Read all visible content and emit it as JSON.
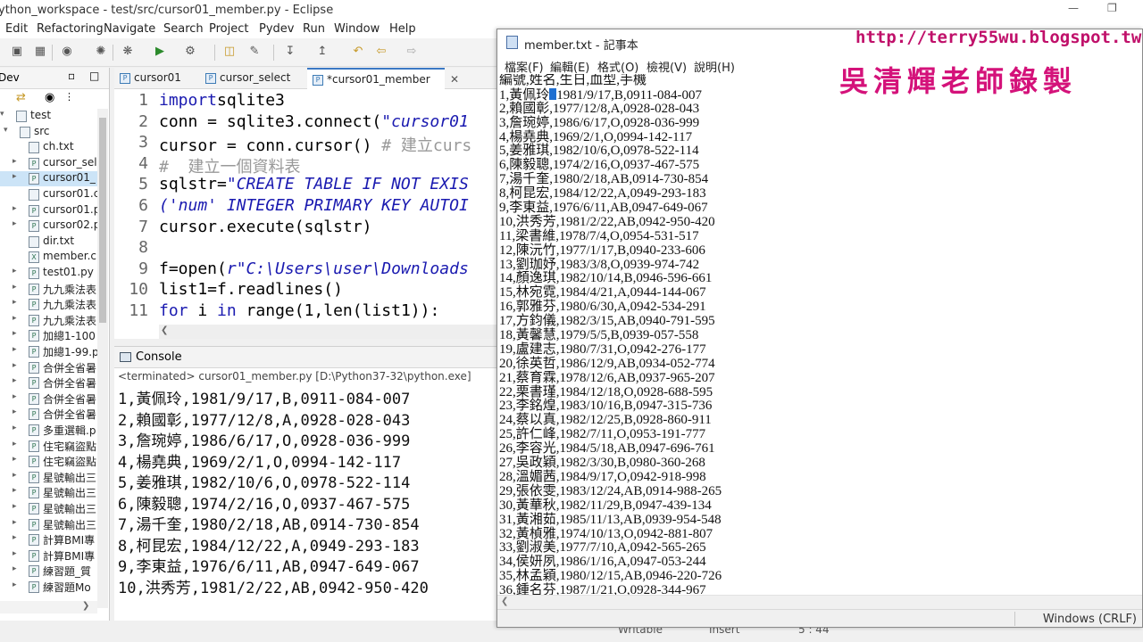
{
  "eclipse": {
    "title": "ython_workspace - test/src/cursor01_member.py - Eclipse",
    "menu": [
      "Edit",
      "Refactoring",
      "Navigate",
      "Search",
      "Project",
      "Pydev",
      "Run",
      "Window",
      "Help"
    ],
    "pkg_tab": "Dev",
    "tree": [
      {
        "label": "test",
        "kind": "project",
        "level": 0,
        "arrow": "open"
      },
      {
        "label": "src",
        "kind": "folder",
        "level": 1,
        "arrow": "open"
      },
      {
        "label": "ch.txt",
        "kind": "file",
        "level": 2,
        "arrow": ""
      },
      {
        "label": "cursor_sel",
        "kind": "py",
        "level": 2,
        "arrow": "closed"
      },
      {
        "label": "cursor01_",
        "kind": "py",
        "level": 2,
        "arrow": "closed",
        "selected": true
      },
      {
        "label": "cursor01.c",
        "kind": "file",
        "level": 2,
        "arrow": ""
      },
      {
        "label": "cursor01.p",
        "kind": "py",
        "level": 2,
        "arrow": "closed"
      },
      {
        "label": "cursor02.p",
        "kind": "py",
        "level": 2,
        "arrow": "closed"
      },
      {
        "label": "dir.txt",
        "kind": "file",
        "level": 2,
        "arrow": ""
      },
      {
        "label": "member.c",
        "kind": "x",
        "level": 2,
        "arrow": ""
      },
      {
        "label": "test01.py",
        "kind": "py",
        "level": 2,
        "arrow": "closed"
      },
      {
        "label": "九九乘法表",
        "kind": "py",
        "level": 2,
        "arrow": "closed"
      },
      {
        "label": "九九乘法表",
        "kind": "py",
        "level": 2,
        "arrow": "closed"
      },
      {
        "label": "九九乘法表",
        "kind": "py",
        "level": 2,
        "arrow": "closed"
      },
      {
        "label": "加總1-100",
        "kind": "py",
        "level": 2,
        "arrow": "closed"
      },
      {
        "label": "加總1-99.p",
        "kind": "py",
        "level": 2,
        "arrow": "closed"
      },
      {
        "label": "合併全省暑",
        "kind": "py",
        "level": 2,
        "arrow": "closed"
      },
      {
        "label": "合併全省暑",
        "kind": "py",
        "level": 2,
        "arrow": "closed"
      },
      {
        "label": "合併全省暑",
        "kind": "py",
        "level": 2,
        "arrow": "closed"
      },
      {
        "label": "合併全省暑",
        "kind": "py",
        "level": 2,
        "arrow": "closed"
      },
      {
        "label": "多重選輯.p",
        "kind": "py",
        "level": 2,
        "arrow": "closed"
      },
      {
        "label": "住宅竊盜點",
        "kind": "py",
        "level": 2,
        "arrow": "closed"
      },
      {
        "label": "住宅竊盜點",
        "kind": "py",
        "level": 2,
        "arrow": "closed"
      },
      {
        "label": "星號輸出三",
        "kind": "py",
        "level": 2,
        "arrow": "closed"
      },
      {
        "label": "星號輸出三",
        "kind": "py",
        "level": 2,
        "arrow": "closed"
      },
      {
        "label": "星號輸出三",
        "kind": "py",
        "level": 2,
        "arrow": "closed"
      },
      {
        "label": "星號輸出三",
        "kind": "py",
        "level": 2,
        "arrow": "closed"
      },
      {
        "label": "計算BMI專",
        "kind": "py",
        "level": 2,
        "arrow": "closed"
      },
      {
        "label": "計算BMI專",
        "kind": "py",
        "level": 2,
        "arrow": "closed"
      },
      {
        "label": "練習題_質",
        "kind": "py",
        "level": 2,
        "arrow": "closed"
      },
      {
        "label": "練習題Mo",
        "kind": "py",
        "level": 2,
        "arrow": "closed"
      }
    ],
    "editor_tabs": [
      {
        "label": "cursor01",
        "active": false
      },
      {
        "label": "cursor_select",
        "active": false
      },
      {
        "label": "*cursor01_member",
        "active": true
      }
    ],
    "code_lines": [
      {
        "n": "1",
        "parts": [
          [
            "kw",
            "import"
          ],
          [
            "",
            "sqlite3"
          ]
        ]
      },
      {
        "n": "2",
        "parts": [
          [
            "",
            "conn = sqlite3.connect("
          ],
          [
            "str",
            "\"cursor01"
          ]
        ]
      },
      {
        "n": "3",
        "parts": [
          [
            "",
            "cursor = conn.cursor() "
          ],
          [
            "cm",
            "# 建立curs"
          ]
        ]
      },
      {
        "n": "4",
        "parts": [
          [
            "cm",
            "#  建立一個資料表"
          ]
        ]
      },
      {
        "n": "5",
        "parts": [
          [
            "",
            "sqlstr="
          ],
          [
            "str",
            "\"CREATE TABLE IF NOT EXIS"
          ]
        ]
      },
      {
        "n": "6",
        "parts": [
          [
            "str",
            "('num' INTEGER PRIMARY KEY AUTOI"
          ]
        ]
      },
      {
        "n": "7",
        "parts": [
          [
            "",
            "cursor.execute(sqlstr)"
          ]
        ]
      },
      {
        "n": "8",
        "parts": [
          [
            "",
            ""
          ]
        ]
      },
      {
        "n": "9",
        "parts": [
          [
            "",
            "f=open("
          ],
          [
            "str",
            "r\"C:\\Users\\user\\Downloads"
          ]
        ]
      },
      {
        "n": "10",
        "parts": [
          [
            "",
            "list1=f.readlines()"
          ]
        ]
      },
      {
        "n": "11",
        "parts": [
          [
            "kw",
            "for"
          ],
          [
            "",
            " i "
          ],
          [
            "kw",
            "in"
          ],
          [
            "",
            " range(1,len(list1)):"
          ]
        ]
      }
    ],
    "console_tab": "Console",
    "console_info": "<terminated> cursor01_member.py [D:\\Python37-32\\python.exe]",
    "console_output": [
      "1,黃佩玲,1981/9/17,B,0911-084-007",
      "2,賴國彰,1977/12/8,A,0928-028-043",
      "3,詹琬婷,1986/6/17,O,0928-036-999",
      "4,楊堯典,1969/2/1,O,0994-142-117",
      "5,姜雅琪,1982/10/6,O,0978-522-114",
      "6,陳毅聰,1974/2/16,O,0937-467-575",
      "7,湯千奎,1980/2/18,AB,0914-730-854",
      "8,柯昆宏,1984/12/22,A,0949-293-183",
      "9,李東益,1976/6/11,AB,0947-649-067",
      "10,洪秀芳,1981/2/22,AB,0942-950-420"
    ],
    "status": {
      "writable": "Writable",
      "insert": "Insert",
      "pos": "5 : 44"
    }
  },
  "notepad": {
    "title": "member.txt - 記事本",
    "menu": [
      "檔案(F)",
      "編輯(E)",
      "格式(O)",
      "檢視(V)",
      "說明(H)"
    ],
    "header_line": "編號,姓名,生日,血型,手機",
    "first_line_before_caret": "1,黃佩玲",
    "first_line_after_caret": "1981/9/17,B,0911-084-007",
    "lines": [
      "2,賴國彰,1977/12/8,A,0928-028-043",
      "3,詹琬婷,1986/6/17,O,0928-036-999",
      "4,楊堯典,1969/2/1,O,0994-142-117",
      "5,姜雅琪,1982/10/6,O,0978-522-114",
      "6,陳毅聰,1974/2/16,O,0937-467-575",
      "7,湯千奎,1980/2/18,AB,0914-730-854",
      "8,柯昆宏,1984/12/22,A,0949-293-183",
      "9,李東益,1976/6/11,AB,0947-649-067",
      "10,洪秀芳,1981/2/22,AB,0942-950-420",
      "11,梁書維,1978/7/4,O,0954-531-517",
      "12,陳沅竹,1977/1/17,B,0940-233-606",
      "13,劉珈妤,1983/3/8,O,0939-974-742",
      "14,顏逸琪,1982/10/14,B,0946-596-661",
      "15,林宛霓,1984/4/21,A,0944-144-067",
      "16,郭雅芬,1980/6/30,A,0942-534-291",
      "17,方鈞儀,1982/3/15,AB,0940-791-595",
      "18,黃馨慧,1979/5/5,B,0939-057-558",
      "19,盧建志,1980/7/31,O,0942-276-177",
      "20,徐英哲,1986/12/9,AB,0934-052-774",
      "21,蔡育霖,1978/12/6,AB,0937-965-207",
      "22,栗書瑾,1984/12/18,O,0928-688-595",
      "23,李銘煌,1983/10/16,B,0947-315-736",
      "24,蔡以真,1982/12/25,B,0928-860-911",
      "25,許仁峰,1982/7/11,O,0953-191-777",
      "26,李容光,1984/5/18,AB,0947-696-761",
      "27,吳政穎,1982/3/30,B,0980-360-268",
      "28,溫媚茜,1984/9/17,O,0942-918-998",
      "29,張依雯,1983/12/24,AB,0914-988-265",
      "30,黃華秋,1982/11/29,B,0947-439-134",
      "31,黃湘茹,1985/11/13,AB,0939-954-548",
      "32,黃楨雅,1974/10/13,O,0942-881-807",
      "33,劉淑美,1977/7/10,A,0942-565-265",
      "34,侯妍夙,1986/1/16,A,0947-053-244",
      "35,林孟穎,1980/12/15,AB,0946-220-726",
      "36,鍾名芬,1987/1/21,O,0928-344-967"
    ],
    "encoding": "Windows (CRLF)"
  },
  "watermark": {
    "url": "http://terry55wu.blogspot.tw",
    "name": "吳清輝老師錄製"
  },
  "colors": {
    "keyword": "#1a1ab0",
    "comment": "#999999",
    "watermark": "#d4127a",
    "selection": "#cce4f7"
  }
}
